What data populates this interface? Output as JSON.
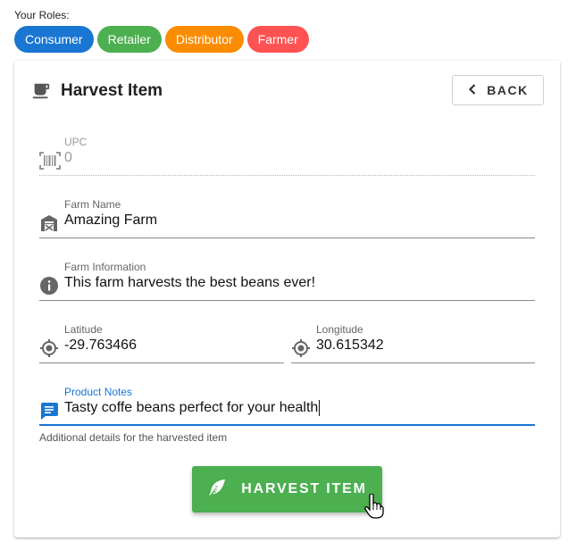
{
  "roles": {
    "label": "Your Roles:",
    "chips": [
      {
        "label": "Consumer",
        "color": "#1976d2"
      },
      {
        "label": "Retailer",
        "color": "#4caf50"
      },
      {
        "label": "Distributor",
        "color": "#fb8c00"
      },
      {
        "label": "Farmer",
        "color": "#ff5252"
      }
    ]
  },
  "card": {
    "title": "Harvest Item",
    "title_icon": "coffee-cup-icon",
    "back_label": "BACK",
    "back_icon": "chevron-left-icon"
  },
  "fields": {
    "upc": {
      "label": "UPC",
      "value": "0",
      "icon": "barcode-scan-icon"
    },
    "farm_name": {
      "label": "Farm Name",
      "value": "Amazing Farm",
      "icon": "barn-icon"
    },
    "farm_info": {
      "label": "Farm Information",
      "value": "This farm harvests the best beans ever!",
      "icon": "info-icon"
    },
    "latitude": {
      "label": "Latitude",
      "value": "-29.763466",
      "icon": "crosshairs-gps-icon"
    },
    "longitude": {
      "label": "Longitude",
      "value": "30.615342",
      "icon": "crosshairs-gps-icon"
    },
    "product_notes": {
      "label": "Product Notes",
      "value": "Tasty coffe beans perfect for your health",
      "icon": "message-text-icon",
      "hint": "Additional details for the harvested item"
    }
  },
  "harvest_button": {
    "label": "HARVEST ITEM",
    "icon": "feather-icon",
    "color": "#4caf50"
  },
  "colors": {
    "focus": "#1976d2",
    "icon_gray": "#666666"
  }
}
